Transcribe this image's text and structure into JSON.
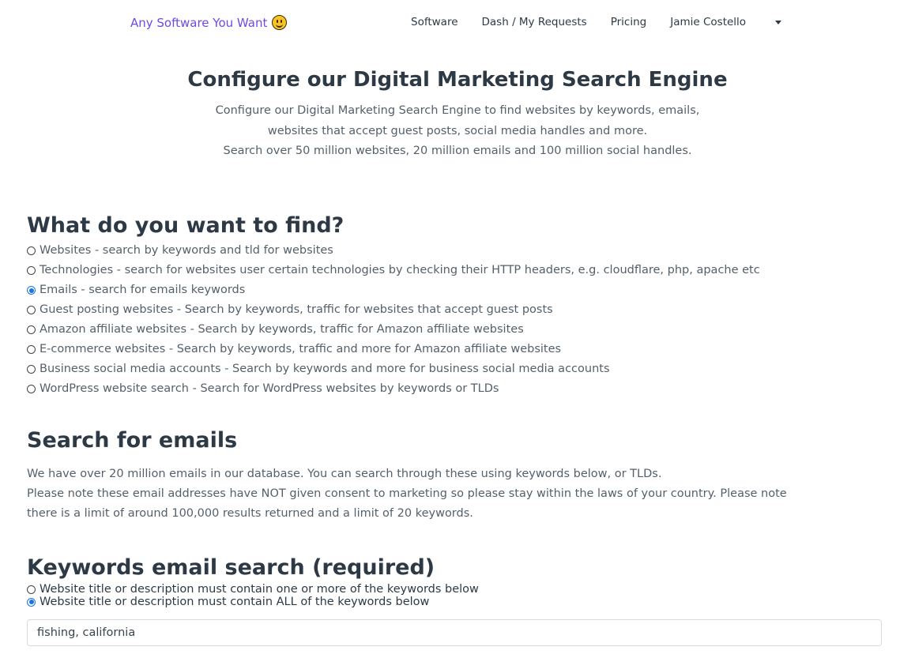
{
  "brand": {
    "text": "Any Software You Want",
    "emoji": "smiley-face-icon"
  },
  "nav": {
    "links": [
      "Software",
      "Dash / My Requests",
      "Pricing"
    ],
    "user": "Jamie Costello"
  },
  "hero": {
    "title": "Configure our Digital Marketing Search Engine",
    "line1": "Configure our Digital Marketing Search Engine to find websites by keywords, emails,",
    "line2": "websites that accept guest posts, social media handles and more.",
    "line3": "Search over 50 million websites, 20 million emails and 100 million social handles."
  },
  "find": {
    "heading": "What do you want to find?",
    "options": [
      {
        "label": "Websites - search by keywords and tld for websites",
        "selected": false
      },
      {
        "label": "Technologies - search for websites user certain technologies by checking their HTTP headers, e.g. cloudflare, php, apache etc",
        "selected": false
      },
      {
        "label": "Emails - search for emails keywords",
        "selected": true
      },
      {
        "label": "Guest posting websites - Search by keywords, traffic for websites that accept guest posts",
        "selected": false
      },
      {
        "label": "Amazon affiliate websites - Search by keywords, traffic for Amazon affiliate websites",
        "selected": false
      },
      {
        "label": "E-commerce websites - Search by keywords, traffic and more for Amazon affiliate websites",
        "selected": false
      },
      {
        "label": "Business social media accounts - Search by keywords and more for business social media accounts",
        "selected": false
      },
      {
        "label": "WordPress website search - Search for WordPress websites by keywords or TLDs",
        "selected": false
      }
    ]
  },
  "emails": {
    "heading": "Search for emails",
    "line1": "We have over 20 million emails in our database. You can search through these using keywords below, or TLDs.",
    "line2": "Please note these email addresses have NOT given consent to marketing so please stay within the laws of your country. Please note",
    "line3": "there is a limit of around 100,000 results returned and a limit of 20 keywords."
  },
  "keywords": {
    "heading": "Keywords email search (required)",
    "options": [
      {
        "label": "Website title or description must contain one or more of the keywords below",
        "selected": false
      },
      {
        "label": "Website title or description must contain ALL of the keywords below",
        "selected": true
      }
    ],
    "input_value": "fishing, california"
  },
  "colors": {
    "brand": "#7048e8",
    "radio_selected": "#1a73e8",
    "text": "#2d3a45",
    "muted": "#55606b"
  }
}
